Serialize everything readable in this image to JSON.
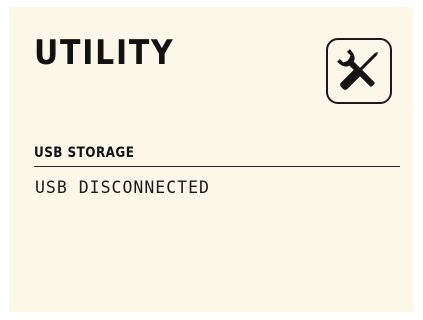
{
  "header": {
    "title": "UTILITY",
    "icon": "tools-icon"
  },
  "usb": {
    "section_label": "USB STORAGE",
    "status": "USB DISCONNECTED"
  },
  "colors": {
    "screen_background": "#fbf8e9",
    "foreground": "#141414"
  }
}
